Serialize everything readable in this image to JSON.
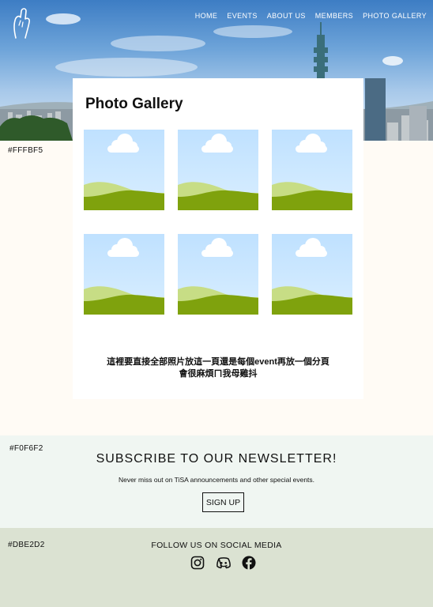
{
  "nav": {
    "items": [
      "HOME",
      "EVENTS",
      "ABOUT US",
      "MEMBERS",
      "PHOTO GALLERY"
    ]
  },
  "logo": {
    "icon": "hand-logo-icon"
  },
  "annotations": {
    "page_bg": "#FFFBF5",
    "newsletter_bg": "#F0F6F2",
    "footer_bg": "#DBE2D2"
  },
  "gallery": {
    "title": "Photo Gallery",
    "note_line1": "這裡要直接全部照片放這一頁還是每個event再放一個分頁",
    "note_line2": "會很麻煩ㄇ我母雞抖",
    "thumbnail_icon": "image-placeholder-icon"
  },
  "newsletter": {
    "title": "SUBSCRIBE TO OUR NEWSLETTER!",
    "subtitle": "Never miss out on TiSA announcements and other special events.",
    "button": "SIGN UP"
  },
  "footer": {
    "follow": "FOLLOW US ON SOCIAL MEDIA",
    "icons": [
      "instagram-icon",
      "discord-icon",
      "facebook-icon"
    ]
  },
  "colors": {
    "page_bg": "#FFFBF5",
    "newsletter_bg": "#F0F6F2",
    "footer_bg": "#DBE2D2",
    "thumb_sky": "#BFE1FF",
    "thumb_hill_light": "#C7DD85",
    "thumb_hill_dark": "#7FA20D"
  }
}
